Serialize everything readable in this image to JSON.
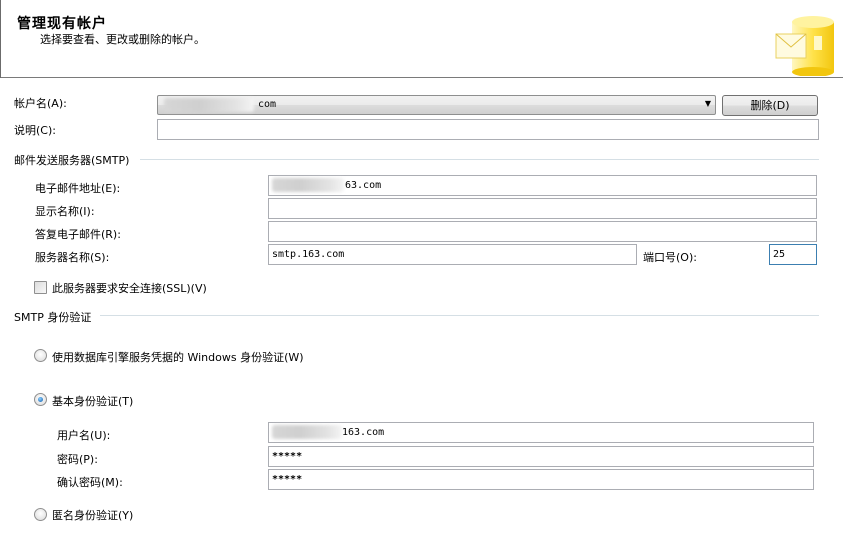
{
  "header": {
    "title": "管理现有帐户",
    "subtitle": "选择要查看、更改或删除的帐户。"
  },
  "account": {
    "name_label": "帐户名(A):",
    "name_value_suffix": "com",
    "delete_label": "删除(D)",
    "description_label": "说明(C):",
    "description_value": ""
  },
  "smtp": {
    "group_label": "邮件发送服务器(SMTP)",
    "email_label": "电子邮件地址(E):",
    "email_value_suffix": "63.com",
    "display_name_label": "显示名称(I):",
    "display_name_value": "",
    "reply_label": "答复电子邮件(R):",
    "reply_value": "",
    "server_label": "服务器名称(S):",
    "server_value": "smtp.163.com",
    "port_label": "端口号(O):",
    "port_value": "25",
    "ssl_label": "此服务器要求安全连接(SSL)(V)"
  },
  "auth": {
    "group_label": "SMTP 身份验证",
    "windows_label": "使用数据库引擎服务凭据的 Windows 身份验证(W)",
    "basic_label": "基本身份验证(T)",
    "username_label": "用户名(U):",
    "username_value_suffix": "163.com",
    "password_label": "密码(P):",
    "password_value": "*****",
    "confirm_label": "确认密码(M):",
    "confirm_value": "*****",
    "anonymous_label": "匿名身份验证(Y)",
    "selected": "basic"
  },
  "colors": {
    "accent_border": "#3c7fb1",
    "radio_dot": "#0d5aa8"
  }
}
